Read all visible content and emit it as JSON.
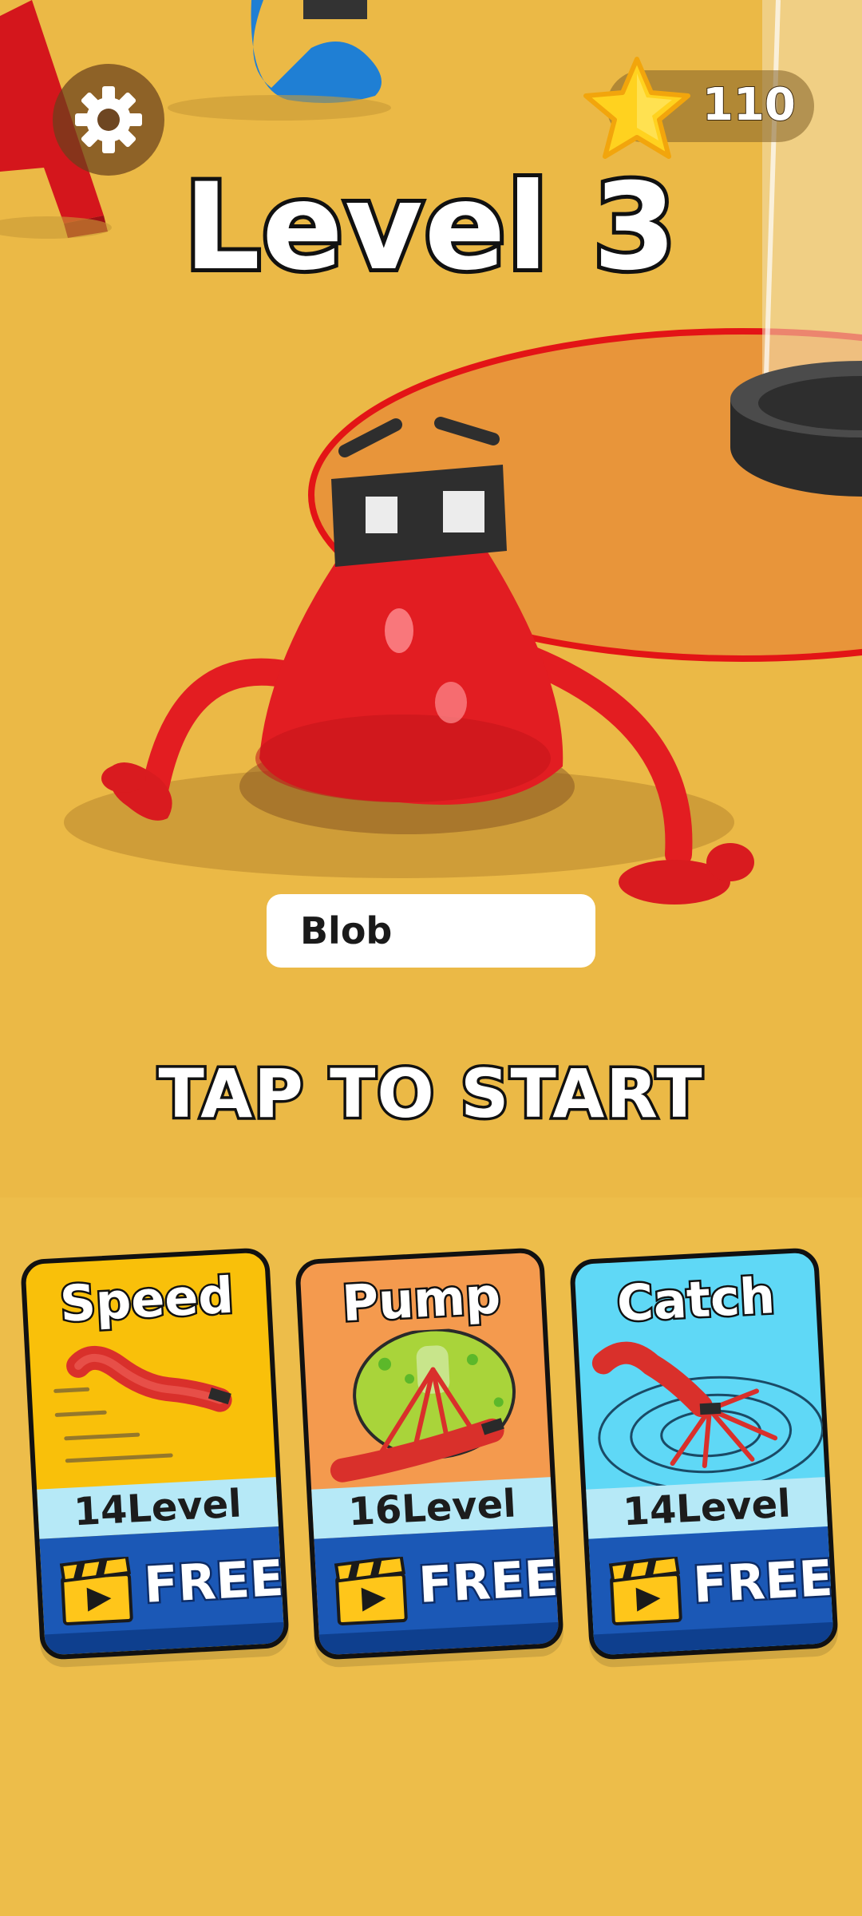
{
  "hud": {
    "settings_icon": "gear-icon",
    "coin_icon": "star-icon",
    "coins": "110"
  },
  "level": {
    "title": "Level 3"
  },
  "character": {
    "name": "Blob"
  },
  "prompt": {
    "start": "TAP TO START"
  },
  "upgrades": [
    {
      "title": "Speed",
      "level": "14Level",
      "cta": "FREE",
      "cta_icon": "video-ad-icon",
      "color": "#f9c00a"
    },
    {
      "title": "Pump",
      "level": "16Level",
      "cta": "FREE",
      "cta_icon": "video-ad-icon",
      "color": "#f49a4e"
    },
    {
      "title": "Catch",
      "level": "14Level",
      "cta": "FREE",
      "cta_icon": "video-ad-icon",
      "color": "#5fd8f6"
    }
  ],
  "colors": {
    "ground": "#ebb946",
    "blob": "#e31d21",
    "zone": "#e8953a",
    "free_bar": "#1b58b6"
  }
}
